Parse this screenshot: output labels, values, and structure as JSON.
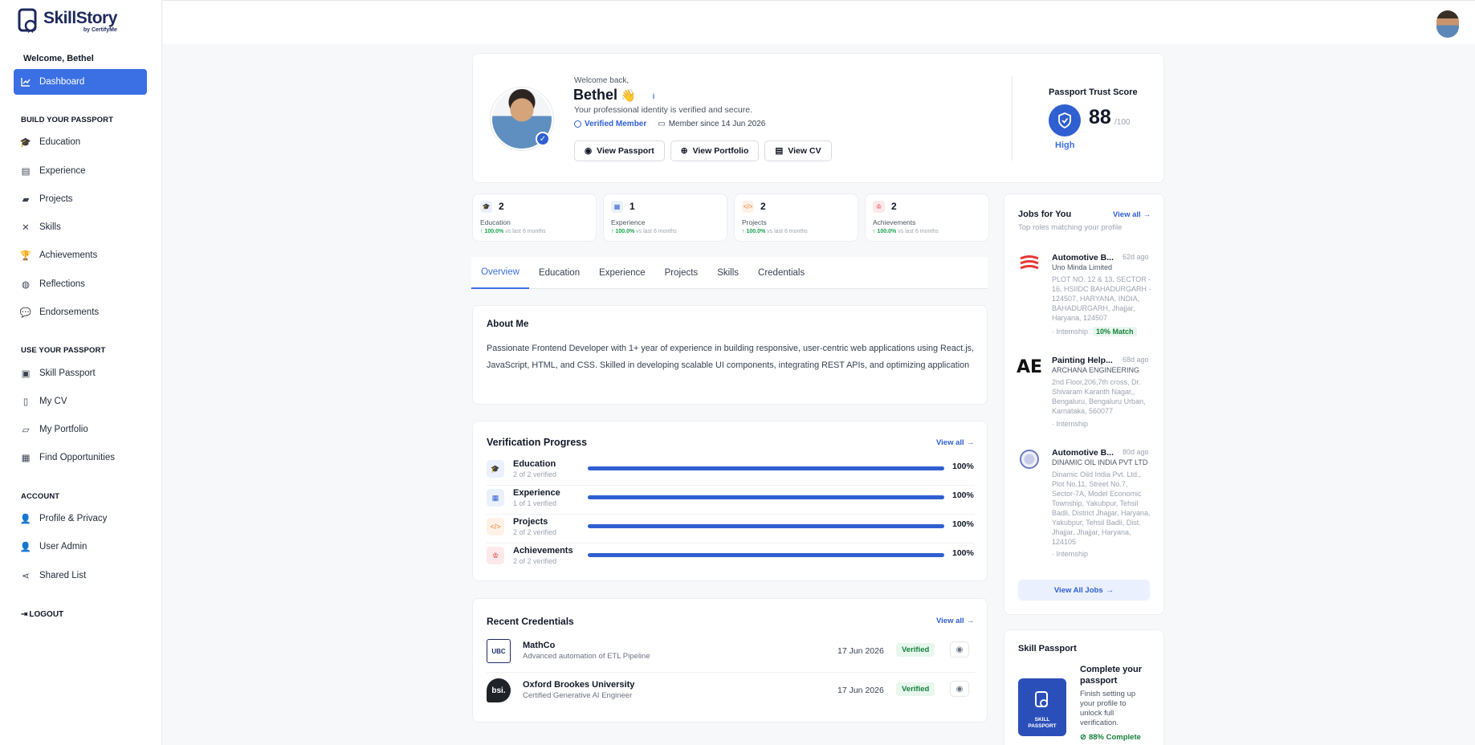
{
  "brand": {
    "name": "SkillStory",
    "sub": "by CertifyMe"
  },
  "sidebar": {
    "welcome": "Welcome, Bethel",
    "dashboard": "Dashboard",
    "sections": [
      "BUILD YOUR PASSPORT",
      "USE YOUR PASSPORT",
      "ACCOUNT"
    ],
    "build": [
      "Education",
      "Experience",
      "Projects",
      "Skills",
      "Achievements",
      "Reflections",
      "Endorsements"
    ],
    "use": [
      "Skill Passport",
      "My CV",
      "My Portfolio",
      "Find Opportunities"
    ],
    "account": [
      "Profile & Privacy",
      "User Admin",
      "Shared List"
    ],
    "logout": "LOGOUT"
  },
  "hero": {
    "welcome": "Welcome back,",
    "name": "Bethel",
    "wave": "👋",
    "desc": "Your professional identity is verified and secure.",
    "verified": "Verified Member",
    "member_since": "Member since 14 Jun 2026",
    "btn_passport": "View Passport",
    "btn_portfolio": "View Portfolio",
    "btn_cv": "View CV",
    "trust_title": "Passport Trust Score",
    "trust_score": "88",
    "trust_max": "/100",
    "trust_level": "High"
  },
  "stats": [
    {
      "num": "2",
      "label": "Education",
      "pct": "100.0%",
      "vs": "vs last 6 months"
    },
    {
      "num": "1",
      "label": "Experience",
      "pct": "100.0%",
      "vs": "vs last 6 months"
    },
    {
      "num": "2",
      "label": "Projects",
      "pct": "100.0%",
      "vs": "vs last 6 months"
    },
    {
      "num": "2",
      "label": "Achievements",
      "pct": "100.0%",
      "vs": "vs last 6 months"
    }
  ],
  "tabs": [
    "Overview",
    "Education",
    "Experience",
    "Projects",
    "Skills",
    "Credentials"
  ],
  "about": {
    "title": "About Me",
    "text": "Passionate Frontend Developer with 1+ year of experience in building responsive, user-centric web applications using React.js, JavaScript, HTML, and CSS. Skilled in developing scalable UI components, integrating REST APIs, and optimizing application"
  },
  "verification": {
    "title": "Verification Progress",
    "view_all": "View all",
    "rows": [
      {
        "name": "Education",
        "sub": "2 of 2 verified",
        "pct": "100%",
        "value": 1.0
      },
      {
        "name": "Experience",
        "sub": "1 of 1 verified",
        "pct": "100%",
        "value": 1.0
      },
      {
        "name": "Projects",
        "sub": "2 of 2 verified",
        "pct": "100%",
        "value": 1.0
      },
      {
        "name": "Achievements",
        "sub": "2 of 2 verified",
        "pct": "100%",
        "value": 1.0
      }
    ]
  },
  "credentials": {
    "title": "Recent Credentials",
    "view_all": "View all",
    "rows": [
      {
        "name": "MathCo",
        "sub": "Advanced automation of ETL Pipeline",
        "date": "17 Jun 2026",
        "status": "Verified",
        "logo": "UBC"
      },
      {
        "name": "Oxford Brookes University",
        "sub": "Certified Generative AI Engineer",
        "date": "17 Jun 2026",
        "status": "Verified",
        "logo": "bsi."
      }
    ]
  },
  "jobs": {
    "title": "Jobs for You",
    "sub": "Top roles matching your profile",
    "view_all": "View all",
    "items": [
      {
        "title": "Automotive B...",
        "age": "62d ago",
        "company": "Uno Minda Limited",
        "address": "PLOT NO. 12 & 13, SECTOR - 16, HSIIDC BAHADURGARH - 124507, HARYANA, INDIA, BAHADURGARH, Jhajjar, Haryana, 124507",
        "type": "· Internship",
        "match": "10% Match"
      },
      {
        "title": "Painting Help...",
        "age": "68d ago",
        "company": "ARCHANA ENGINEERING",
        "address": "2nd Floor,206,7th cross, Dr. Shivaram Karanth Nagar,, Bengaluru, Bengaluru Urban, Karnataka, 560077",
        "type": "· Internship",
        "match": ""
      },
      {
        "title": "Automotive B...",
        "age": "80d ago",
        "company": "DINAMIC OIL INDIA PVT LTD",
        "address": "Dinamic Oild India Pvt. Ltd., Plot No.11, Street No.7, Sector-7A, Model Economic Township, Yakubpur, Tehsil Badli, District Jhajjar, Haryana, Yakubpur, Tehsil Badli, Dist. Jhajjar, Jhajjar, Haryana, 124105",
        "type": "· Internship",
        "match": ""
      }
    ],
    "btn": "View All Jobs"
  },
  "passport": {
    "title": "Skill Passport",
    "card": "SKILL PASSPORT",
    "head": "Complete your passport",
    "desc": "Finish setting up your profile to unlock full verification.",
    "pct": "88% Complete"
  }
}
